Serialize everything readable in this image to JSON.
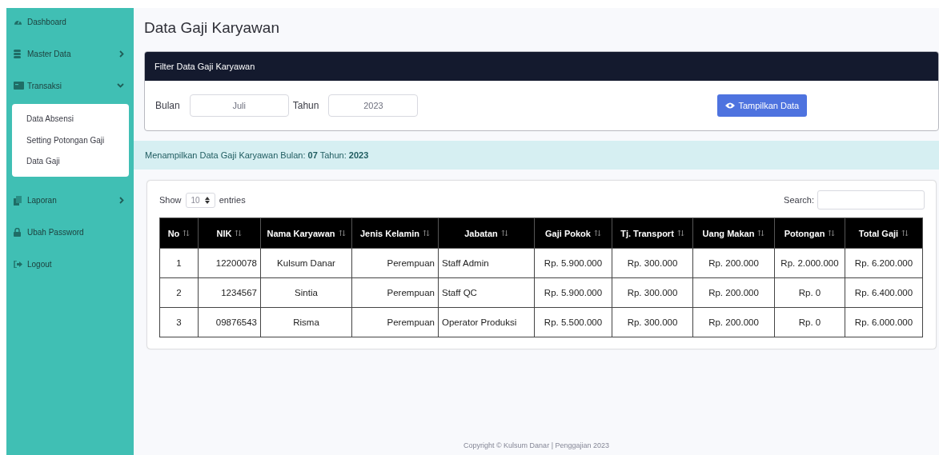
{
  "sidebar": {
    "items": [
      {
        "label": "Dashboard",
        "kind": "link"
      },
      {
        "label": "Master Data",
        "kind": "menu",
        "expanded": false
      },
      {
        "label": "Transaksi",
        "kind": "menu",
        "expanded": true,
        "children": [
          {
            "label": "Data Absensi"
          },
          {
            "label": "Setting Potongan Gaji"
          },
          {
            "label": "Data Gaji"
          }
        ]
      },
      {
        "label": "Laporan",
        "kind": "menu",
        "expanded": false
      },
      {
        "label": "Ubah Password",
        "kind": "link"
      },
      {
        "label": "Logout",
        "kind": "link"
      }
    ]
  },
  "page_title": "Data Gaji Karyawan",
  "filter": {
    "title": "Filter Data Gaji Karyawan",
    "month_label": "Bulan",
    "month_value": "Juli",
    "year_label": "Tahun",
    "year_value": "2023",
    "button": "Tampilkan Data"
  },
  "info": "Menampilkan Data Gaji Karyawan Bulan: **07** Tahun: **2023**",
  "table": {
    "show_label": "Show",
    "page_size": "10",
    "entries_label": "entries",
    "search_label": "Search:",
    "columns": [
      "No",
      "NIK",
      "Nama Karyawan",
      "Jenis Kelamin",
      "Jabatan",
      "Gaji Pokok",
      "Tj. Transport",
      "Uang Makan",
      "Potongan",
      "Total Gaji"
    ],
    "rows": [
      [
        "1",
        "12200078",
        "Kulsum Danar",
        "Perempuan",
        "Staff Admin",
        "Rp. 5.900.000",
        "Rp. 300.000",
        "Rp. 200.000",
        "Rp. 2.000.000",
        "Rp. 6.200.000"
      ],
      [
        "2",
        "1234567",
        "Sintia",
        "Perempuan",
        "Staff QC",
        "Rp. 5.900.000",
        "Rp. 300.000",
        "Rp. 200.000",
        "Rp. 0",
        "Rp. 6.400.000"
      ],
      [
        "3",
        "09876543",
        "Risma",
        "Perempuan",
        "Operator Produksi",
        "Rp. 5.500.000",
        "Rp. 300.000",
        "Rp. 200.000",
        "Rp. 0",
        "Rp. 6.000.000"
      ]
    ]
  },
  "footer": "Copyright © Kulsum Danar | Penggajian 2023"
}
